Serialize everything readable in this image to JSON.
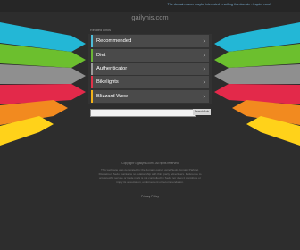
{
  "topbar": {
    "link_text": "The domain owner maybe interested in selling this domain - Inquire now!"
  },
  "domain": "gailyhis.com",
  "related_label": "Related Links",
  "links": [
    {
      "label": "Recommended",
      "color": "#4fbcd8"
    },
    {
      "label": "Diet",
      "color": "#6bb536"
    },
    {
      "label": "Authenticator",
      "color": "#9c9c9c"
    },
    {
      "label": "Bikelights",
      "color": "#e0334a"
    },
    {
      "label": "Blizzard Wow",
      "color": "#f2b31a"
    }
  ],
  "search": {
    "button_label": "Search Ads",
    "placeholder": ""
  },
  "footer": {
    "copyright": "Copyright © gailyhis.com - All rights reserved",
    "disclaimer": "This webpage was generated by the domain owner using Sedo Domain Parking. Disclaimer: Sedo maintains no relationship with third party advertisers. Reference to any specific service or trade mark is not controlled by Sedo nor does it constitute or imply its association, endorsement or recommendation.",
    "privacy": "Privacy Policy"
  },
  "wing_colors": [
    "#23b7d6",
    "#6cbf2e",
    "#8f8f8f",
    "#e3294a",
    "#f28a1f",
    "#ffd21a"
  ]
}
